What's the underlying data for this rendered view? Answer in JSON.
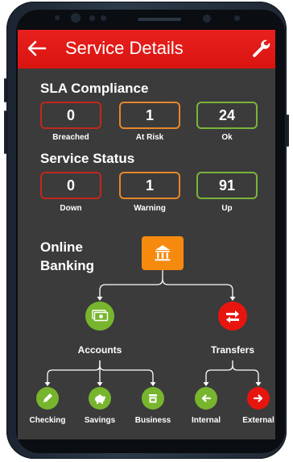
{
  "app_bar": {
    "title": "Service Details",
    "back_icon": "arrow-left-icon",
    "settings_icon": "wrench-icon",
    "color": "#e8201e"
  },
  "sla_compliance": {
    "title": "SLA Compliance",
    "metrics": [
      {
        "value": "0",
        "label": "Breached",
        "color": "#c0281d"
      },
      {
        "value": "1",
        "label": "At Risk",
        "color": "#e6862a"
      },
      {
        "value": "24",
        "label": "Ok",
        "color": "#79b43a"
      }
    ]
  },
  "service_status": {
    "title": "Service Status",
    "metrics": [
      {
        "value": "0",
        "label": "Down",
        "color": "#c0281d"
      },
      {
        "value": "1",
        "label": "Warning",
        "color": "#e6862a"
      },
      {
        "value": "91",
        "label": "Up",
        "color": "#79b43a"
      }
    ]
  },
  "service_tree": {
    "root": {
      "label": "Online Banking",
      "icon": "bank-icon",
      "color": "#f58a0f"
    },
    "branches": [
      {
        "label": "Accounts",
        "icon": "money-icon",
        "color": "#78b52e"
      },
      {
        "label": "Transfers",
        "icon": "transfer-icon",
        "color": "#e8150f"
      }
    ],
    "leaves": [
      {
        "label": "Checking",
        "icon": "pen-icon",
        "color": "#78b52e"
      },
      {
        "label": "Savings",
        "icon": "piggy-bank-icon",
        "color": "#78b52e"
      },
      {
        "label": "Business",
        "icon": "store-icon",
        "color": "#78b52e"
      },
      {
        "label": "Internal",
        "icon": "arrow-left-icon",
        "color": "#78b52e"
      },
      {
        "label": "External",
        "icon": "arrow-right-icon",
        "color": "#e8150f"
      }
    ]
  }
}
